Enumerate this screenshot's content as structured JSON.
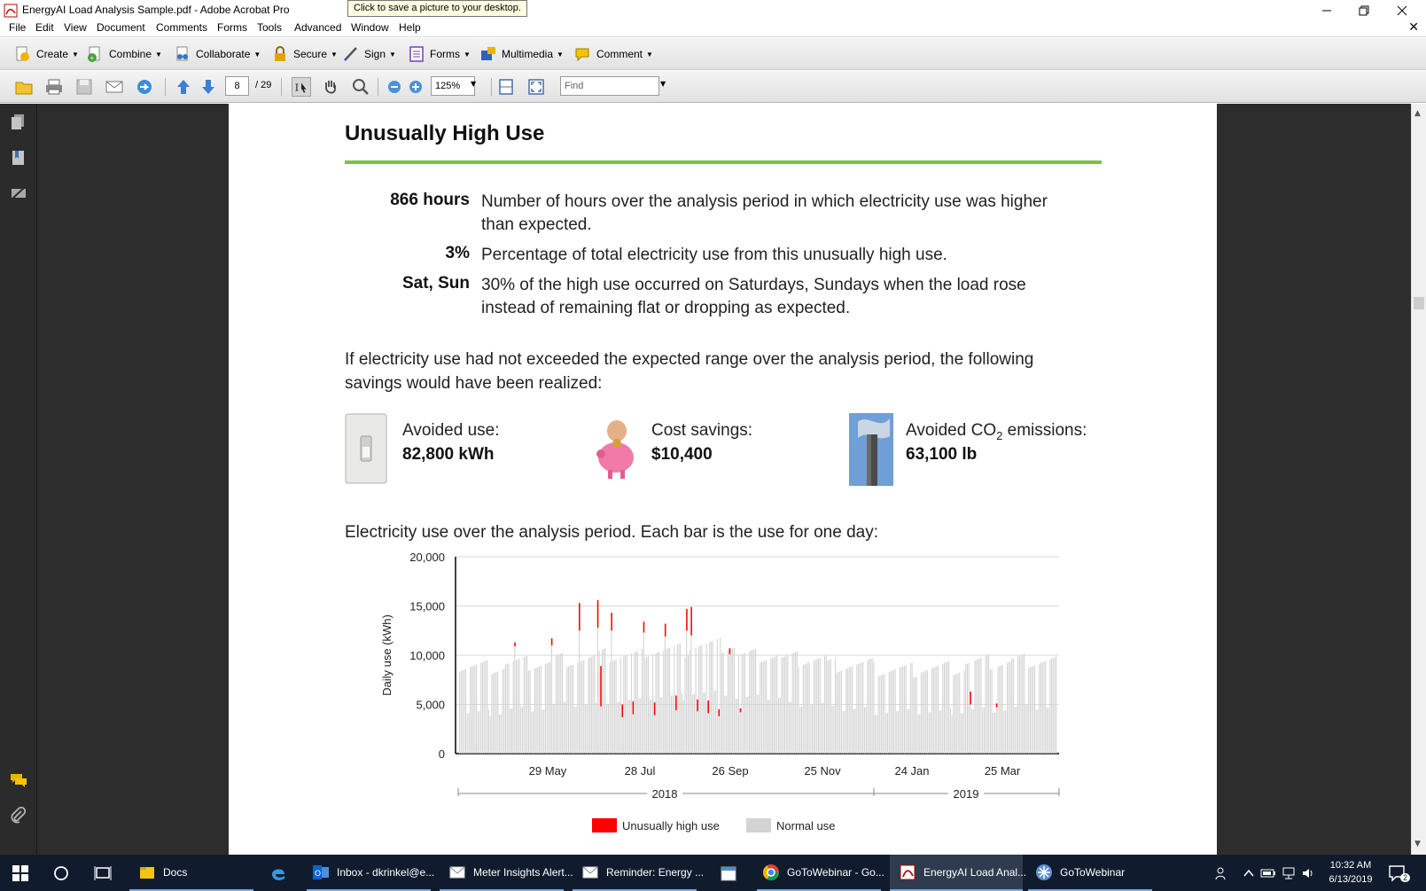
{
  "window": {
    "title": "EnergyAI Load Analysis Sample.pdf - Adobe Acrobat Pro",
    "tooltip": "Click to save a picture to your desktop."
  },
  "menu": [
    "File",
    "Edit",
    "View",
    "Document",
    "Comments",
    "Forms",
    "Tools",
    "Advanced",
    "Window",
    "Help"
  ],
  "toolbar1": {
    "create": "Create",
    "combine": "Combine",
    "collaborate": "Collaborate",
    "secure": "Secure",
    "sign": "Sign",
    "forms": "Forms",
    "multimedia": "Multimedia",
    "comment": "Comment"
  },
  "toolbar2": {
    "page_current": "8",
    "page_total": "/ 29",
    "zoom": "125%",
    "find_placeholder": "Find"
  },
  "doc": {
    "heading": "Unusually High Use",
    "stats": [
      {
        "value": "866 hours",
        "desc": "Number of hours over the analysis period in which electricity use was higher than expected."
      },
      {
        "value": "3%",
        "desc": "Percentage of total electricity use from this unusually high use."
      },
      {
        "value": "Sat, Sun",
        "desc": "30% of the high use occurred on Saturdays, Sundays when the load rose instead of remaining flat or dropping as expected."
      }
    ],
    "savings_intro": "If electricity use had not exceeded the expected range over the analysis period, the following savings would have been realized:",
    "savings": [
      {
        "label": "Avoided use:",
        "value": "82,800 kWh"
      },
      {
        "label": "Cost savings:",
        "value": "$10,400"
      },
      {
        "label_pre": "Avoided CO",
        "label_sub": "2",
        "label_post": " emissions:",
        "value": "63,100 lb"
      }
    ],
    "chart_caption": "Electricity use over the analysis period. Each bar is the use for one day:"
  },
  "chart_data": {
    "type": "bar",
    "ylabel": "Daily use (kWh)",
    "ylim": [
      0,
      20000
    ],
    "yticks": [
      "0",
      "5,000",
      "10,000",
      "15,000",
      "20,000"
    ],
    "xtick_labels": [
      "29 May",
      "28 Jul",
      "26 Sep",
      "25 Nov",
      "24 Jan",
      "25 Mar"
    ],
    "year_labels": [
      "2018",
      "2019"
    ],
    "grid": true,
    "legend": [
      "Unusually high use",
      "Normal use"
    ],
    "colors": {
      "high": "#ff0000",
      "normal": "#d3d3d3"
    },
    "days": 390,
    "weekly_pattern": {
      "weekday_base": [
        8600,
        9000,
        9400,
        9700,
        10300,
        10800,
        9800,
        9400,
        8800,
        8300,
        8500,
        9100,
        9300
      ],
      "weekend_base": [
        3800,
        4200,
        4600,
        5000,
        5400,
        5800,
        5300,
        4700,
        4200,
        3900,
        3900,
        4100,
        4300
      ]
    },
    "high_use_days": [
      {
        "day": 36,
        "normal": 10900,
        "high": 11300
      },
      {
        "day": 60,
        "normal": 11000,
        "high": 11700
      },
      {
        "day": 78,
        "normal": 12500,
        "high": 15300
      },
      {
        "day": 90,
        "normal": 12800,
        "high": 15600
      },
      {
        "day": 92,
        "normal": 4800,
        "high": 8900
      },
      {
        "day": 99,
        "normal": 12500,
        "high": 14300
      },
      {
        "day": 106,
        "normal": 3700,
        "high": 5000
      },
      {
        "day": 113,
        "normal": 4000,
        "high": 5300
      },
      {
        "day": 120,
        "normal": 12300,
        "high": 13400
      },
      {
        "day": 127,
        "normal": 3900,
        "high": 5200
      },
      {
        "day": 134,
        "normal": 11900,
        "high": 13200
      },
      {
        "day": 141,
        "normal": 4400,
        "high": 5900
      },
      {
        "day": 148,
        "normal": 12500,
        "high": 14700
      },
      {
        "day": 151,
        "normal": 12000,
        "high": 14900
      },
      {
        "day": 155,
        "normal": 4300,
        "high": 5500
      },
      {
        "day": 162,
        "normal": 4100,
        "high": 5400
      },
      {
        "day": 169,
        "normal": 3800,
        "high": 4500
      },
      {
        "day": 176,
        "normal": 10100,
        "high": 10700
      },
      {
        "day": 183,
        "normal": 4200,
        "high": 4600
      },
      {
        "day": 333,
        "normal": 5000,
        "high": 6300
      },
      {
        "day": 350,
        "normal": 4700,
        "high": 5100
      }
    ]
  },
  "taskbar": {
    "items": [
      "Docs",
      "Inbox - dkrinkel@e...",
      "Meter Insights Alert...",
      "Reminder: Energy ...",
      "GoToWebinar - Go...",
      "EnergyAI Load Anal...",
      "GoToWebinar"
    ],
    "time": "10:32 AM",
    "date": "6/13/2019",
    "notification_count": "2"
  }
}
